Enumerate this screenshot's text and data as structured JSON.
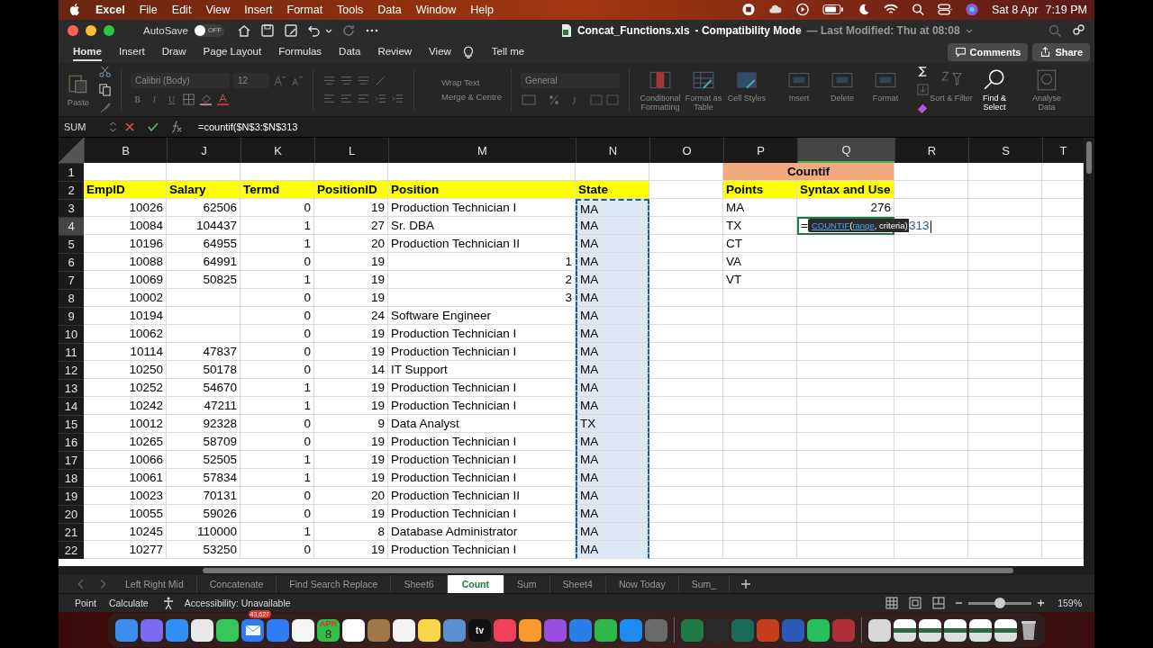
{
  "menu_bar": {
    "app": "Excel",
    "items": [
      "File",
      "Edit",
      "View",
      "Insert",
      "Format",
      "Tools",
      "Data",
      "Window",
      "Help"
    ],
    "date": "Sat 8 Apr",
    "time": "7:19 PM"
  },
  "window": {
    "autosave_label": "AutoSave",
    "autosave": {
      "on": false,
      "label": "OFF"
    },
    "file_name": "Concat_Functions.xls",
    "mode": "-  Compatibility Mode",
    "modified": "— Last Modified: Thu at 08:08"
  },
  "ribbon_tabs": [
    {
      "label": "Home",
      "selected": true
    },
    {
      "label": "Insert",
      "selected": false
    },
    {
      "label": "Draw",
      "selected": false
    },
    {
      "label": "Page Layout",
      "selected": false
    },
    {
      "label": "Formulas",
      "selected": false
    },
    {
      "label": "Data",
      "selected": false
    },
    {
      "label": "Review",
      "selected": false
    },
    {
      "label": "View",
      "selected": false
    }
  ],
  "tell_me": "Tell me",
  "actions": [
    "Comments",
    "Share"
  ],
  "ribbon": {
    "paste": "Paste",
    "font": "Calibri (Body)",
    "size": "12",
    "bold": "B",
    "italic": "I",
    "underline": "U",
    "wrap": "Wrap Text",
    "merge": "Merge & Centre",
    "number_format": "General",
    "buttons": [
      {
        "label": "Conditional Formatting",
        "disabled": true,
        "kind": "cond"
      },
      {
        "label": "Format as Table",
        "disabled": true,
        "kind": "table"
      },
      {
        "label": "Cell Styles",
        "disabled": true,
        "kind": "styles"
      },
      {
        "label": "Insert",
        "disabled": true,
        "kind": "cells"
      },
      {
        "label": "Delete",
        "disabled": true,
        "kind": "cells"
      },
      {
        "label": "Format",
        "disabled": true,
        "kind": "cells"
      },
      {
        "label": "Sort & Filter",
        "disabled": true,
        "kind": "sort"
      },
      {
        "label": "Find & Select",
        "disabled": false,
        "kind": "find"
      },
      {
        "label": "Analyse Data",
        "disabled": true,
        "kind": "analyse"
      }
    ]
  },
  "formula_bar": {
    "name_box": "SUM",
    "formula": "=countif($N$3:$N$313"
  },
  "sheet": {
    "columns": [
      {
        "letter": "B",
        "kind": "number",
        "selected": false,
        "referenced": false
      },
      {
        "letter": "J",
        "kind": "number",
        "selected": false,
        "referenced": false
      },
      {
        "letter": "K",
        "kind": "number",
        "selected": false,
        "referenced": false
      },
      {
        "letter": "L",
        "kind": "number",
        "selected": false,
        "referenced": false
      },
      {
        "letter": "M",
        "kind": "text",
        "selected": false,
        "referenced": false
      },
      {
        "letter": "N",
        "kind": "text",
        "selected": false,
        "referenced": true
      },
      {
        "letter": "O",
        "kind": "text",
        "selected": false,
        "referenced": false
      },
      {
        "letter": "P",
        "kind": "text",
        "selected": false,
        "referenced": false
      },
      {
        "letter": "Q",
        "kind": "number",
        "selected": true,
        "referenced": false
      },
      {
        "letter": "R",
        "kind": "text",
        "selected": false,
        "referenced": false
      },
      {
        "letter": "S",
        "kind": "text",
        "selected": false,
        "referenced": false
      },
      {
        "letter": "T",
        "kind": "text",
        "selected": false,
        "referenced": false
      }
    ],
    "rows": [
      {
        "number": "1",
        "kind": "title",
        "selected": false,
        "cells": [
          null,
          null,
          null,
          null,
          null,
          null,
          null,
          {
            "kind": "merged",
            "text": "Countif"
          },
          {
            "kind": "covered"
          },
          null,
          null,
          null
        ]
      },
      {
        "number": "2",
        "kind": "header",
        "selected": false,
        "cells": [
          "EmpID",
          "Salary",
          "Termd",
          "PositionID",
          "Position",
          "State",
          null,
          "Points",
          "Syntax and Use",
          null,
          null,
          null
        ]
      },
      {
        "number": "3",
        "kind": "data",
        "selected": false,
        "cells": [
          "10026",
          "62506",
          "0",
          "19",
          "Production Technician I",
          "MA",
          null,
          "MA",
          "276",
          null,
          null,
          null
        ]
      },
      {
        "number": "4",
        "kind": "data",
        "selected": true,
        "cells": [
          "10084",
          "104437",
          "1",
          "27",
          "Sr. DBA",
          "MA",
          null,
          "TX",
          {
            "kind": "editing",
            "start": "=",
            "end": "313",
            "tooltip": [
              {
                "text": "COUNTIF",
                "link": true
              },
              {
                "text": "(",
                "link": false
              },
              {
                "text": "range",
                "link": true
              },
              {
                "text": ", criteria)",
                "link": false
              }
            ]
          },
          null,
          null,
          null
        ]
      },
      {
        "number": "5",
        "kind": "data",
        "selected": false,
        "cells": [
          "10196",
          "64955",
          "1",
          "20",
          "Production Technician II",
          "MA",
          null,
          "CT",
          null,
          null,
          null,
          null
        ]
      },
      {
        "number": "6",
        "kind": "data",
        "selected": false,
        "cells": [
          "10088",
          "64991",
          "0",
          "19",
          {
            "kind": "number",
            "text": "1"
          },
          "MA",
          null,
          "VA",
          null,
          null,
          null,
          null
        ]
      },
      {
        "number": "7",
        "kind": "data",
        "selected": false,
        "cells": [
          "10069",
          "50825",
          "1",
          "19",
          {
            "kind": "number",
            "text": "2"
          },
          "MA",
          null,
          "VT",
          null,
          null,
          null,
          null
        ]
      },
      {
        "number": "8",
        "kind": "data",
        "selected": false,
        "cells": [
          "10002",
          null,
          "0",
          "19",
          {
            "kind": "number",
            "text": "3"
          },
          "MA",
          null,
          null,
          null,
          null,
          null,
          null
        ]
      },
      {
        "number": "9",
        "kind": "data",
        "selected": false,
        "cells": [
          "10194",
          null,
          "0",
          "24",
          "Software Engineer",
          "MA",
          null,
          null,
          null,
          null,
          null,
          null
        ]
      },
      {
        "number": "10",
        "kind": "data",
        "selected": false,
        "cells": [
          "10062",
          null,
          "0",
          "19",
          "Production Technician I",
          "MA",
          null,
          null,
          null,
          null,
          null,
          null
        ]
      },
      {
        "number": "11",
        "kind": "data",
        "selected": false,
        "cells": [
          "10114",
          "47837",
          "0",
          "19",
          "Production Technician I",
          "MA",
          null,
          null,
          null,
          null,
          null,
          null
        ]
      },
      {
        "number": "12",
        "kind": "data",
        "selected": false,
        "cells": [
          "10250",
          "50178",
          "0",
          "14",
          "IT Support",
          "MA",
          null,
          null,
          null,
          null,
          null,
          null
        ]
      },
      {
        "number": "13",
        "kind": "data",
        "selected": false,
        "cells": [
          "10252",
          "54670",
          "1",
          "19",
          "Production Technician I",
          "MA",
          null,
          null,
          null,
          null,
          null,
          null
        ]
      },
      {
        "number": "14",
        "kind": "data",
        "selected": false,
        "cells": [
          "10242",
          "47211",
          "1",
          "19",
          "Production Technician I",
          "MA",
          null,
          null,
          null,
          null,
          null,
          null
        ]
      },
      {
        "number": "15",
        "kind": "data",
        "selected": false,
        "cells": [
          "10012",
          "92328",
          "0",
          "9",
          "Data Analyst",
          "TX",
          null,
          null,
          null,
          null,
          null,
          null
        ]
      },
      {
        "number": "16",
        "kind": "data",
        "selected": false,
        "cells": [
          "10265",
          "58709",
          "0",
          "19",
          "Production Technician I",
          "MA",
          null,
          null,
          null,
          null,
          null,
          null
        ]
      },
      {
        "number": "17",
        "kind": "data",
        "selected": false,
        "cells": [
          "10066",
          "52505",
          "1",
          "19",
          "Production Technician I",
          "MA",
          null,
          null,
          null,
          null,
          null,
          null
        ]
      },
      {
        "number": "18",
        "kind": "data",
        "selected": false,
        "cells": [
          "10061",
          "57834",
          "1",
          "19",
          "Production Technician I",
          "MA",
          null,
          null,
          null,
          null,
          null,
          null
        ]
      },
      {
        "number": "19",
        "kind": "data",
        "selected": false,
        "cells": [
          "10023",
          "70131",
          "0",
          "20",
          "Production Technician II",
          "MA",
          null,
          null,
          null,
          null,
          null,
          null
        ]
      },
      {
        "number": "20",
        "kind": "data",
        "selected": false,
        "cells": [
          "10055",
          "59026",
          "0",
          "19",
          "Production Technician I",
          "MA",
          null,
          null,
          null,
          null,
          null,
          null
        ]
      },
      {
        "number": "21",
        "kind": "data",
        "selected": false,
        "cells": [
          "10245",
          "110000",
          "1",
          "8",
          "Database Administrator",
          "MA",
          null,
          null,
          null,
          null,
          null,
          null
        ]
      },
      {
        "number": "22",
        "kind": "data",
        "selected": false,
        "cells": [
          "10277",
          "53250",
          "0",
          "19",
          "Production Technician I",
          "MA",
          null,
          null,
          null,
          null,
          null,
          null
        ]
      }
    ]
  },
  "sheet_tabs": [
    {
      "label": "Left Right Mid",
      "selected": false
    },
    {
      "label": "Concatenate",
      "selected": false
    },
    {
      "label": "Find Search Replace",
      "selected": false
    },
    {
      "label": "Sheet6",
      "selected": false
    },
    {
      "label": "Count",
      "selected": true
    },
    {
      "label": "Sum",
      "selected": false
    },
    {
      "label": "Sheet4",
      "selected": false
    },
    {
      "label": "Now Today",
      "selected": false
    },
    {
      "label": "Sum_",
      "selected": false
    }
  ],
  "status_bar": {
    "items": [
      "Point",
      "Calculate"
    ],
    "accessibility": "Accessibility: Unavailable",
    "zoom": {
      "level": 0.5,
      "reading": "159%"
    }
  },
  "dock": {
    "mail_badge": "43,627",
    "calendar_month": "APR",
    "calendar_day": "8",
    "tv_label": "tv"
  }
}
